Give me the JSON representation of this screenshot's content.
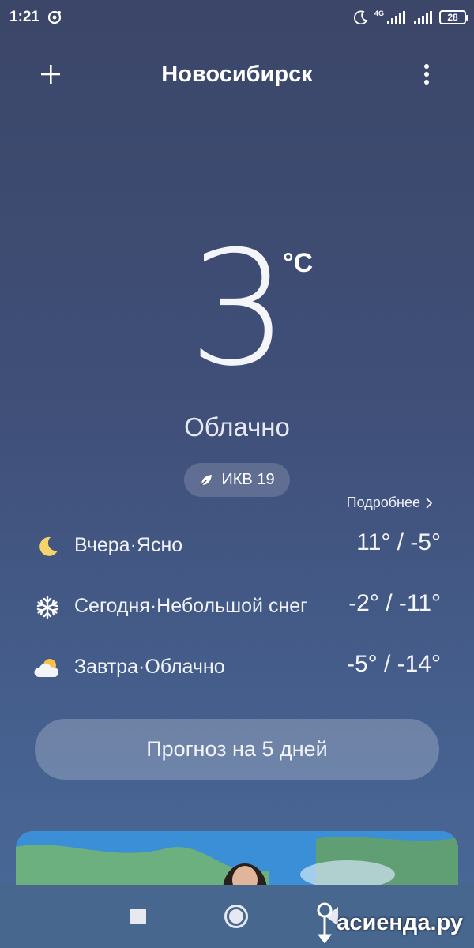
{
  "status_bar": {
    "time": "1:21",
    "network": "4G",
    "battery": "28"
  },
  "header": {
    "city": "Новосибирск",
    "add_icon": "plus-icon",
    "menu_icon": "more-vertical-icon"
  },
  "current": {
    "temperature": "3",
    "unit": "°C",
    "condition": "Облачно"
  },
  "aqi": {
    "label": "ИКВ 19",
    "icon": "leaf-icon"
  },
  "more_link": "Подробнее",
  "forecast": [
    {
      "label": "Вчера·Ясно",
      "temps": "11° / -5°",
      "icon": "moon-icon"
    },
    {
      "label": "Сегодня·Небольшой снег",
      "temps": "-2° / -11°",
      "icon": "snowflake-icon"
    },
    {
      "label": "Завтра·Облачно",
      "temps": "-5° / -14°",
      "icon": "partly-cloudy-icon"
    }
  ],
  "forecast_button": "Прогноз на 5 дней",
  "watermark": "асиенда.ру",
  "colors": {
    "background_top": "#3b4668",
    "background_bottom": "#4a6a99",
    "moon": "#f6d36b",
    "sun": "#f6c04b"
  }
}
